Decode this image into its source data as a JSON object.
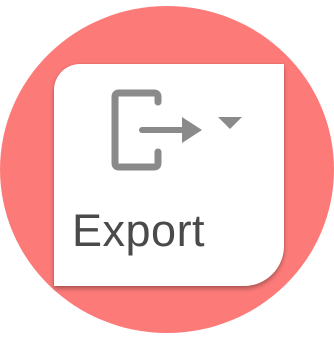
{
  "button": {
    "label": "Export",
    "icon": "export-icon",
    "dropdown_icon": "caret-down-icon"
  },
  "colors": {
    "background_circle": "#fc7b79",
    "card": "#ffffff",
    "icon_gray": "#8a8a8a",
    "label_text": "#4a4a4a"
  }
}
